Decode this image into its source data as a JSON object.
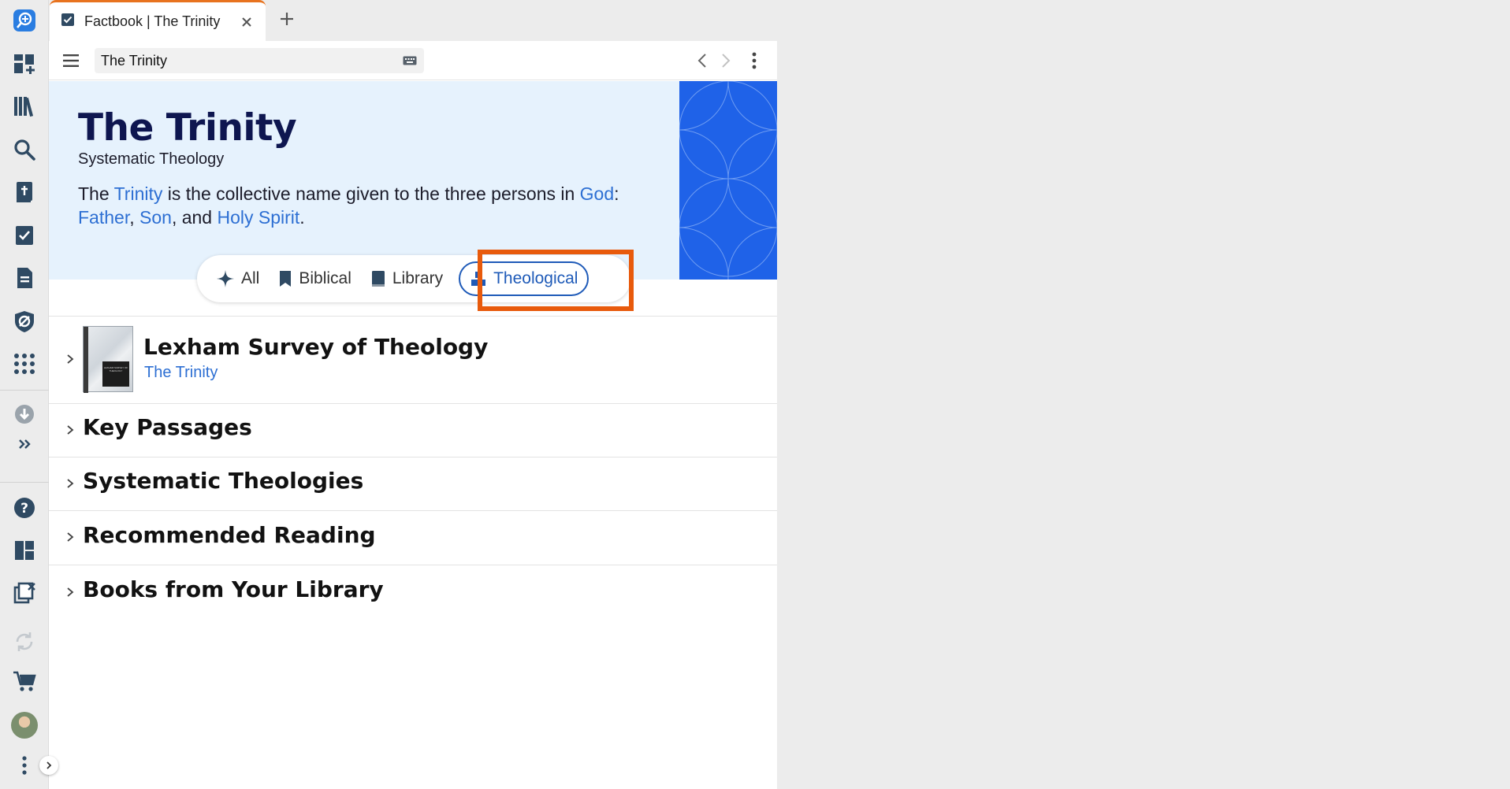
{
  "tab": {
    "title": "Factbook | The Trinity"
  },
  "toolbar": {
    "address_value": "The Trinity"
  },
  "hero": {
    "title": "The Trinity",
    "subtitle": "Systematic Theology",
    "desc_before": "The ",
    "link_trinity": "Trinity",
    "desc_mid1": " is the collective name given to the three persons in ",
    "link_god": "God",
    "desc_mid2": ":",
    "link_father": "Father",
    "desc_sep1": ", ",
    "link_son": "Son",
    "desc_sep2": ", and ",
    "link_holy_spirit": "Holy Spirit",
    "desc_end": "."
  },
  "filters": [
    {
      "label": "All",
      "icon": "sparkle-icon"
    },
    {
      "label": "Biblical",
      "icon": "bookmark-icon"
    },
    {
      "label": "Library",
      "icon": "book-icon"
    },
    {
      "label": "Theological",
      "icon": "blocks-icon",
      "active": true
    }
  ],
  "featured_book": {
    "title": "Lexham Survey of Theology",
    "link": "The Trinity",
    "cover_text": "LEXHAM SURVEY OF THEOLOGY"
  },
  "sections": [
    {
      "title": "Key Passages"
    },
    {
      "title": "Systematic Theologies"
    },
    {
      "title": "Recommended Reading"
    },
    {
      "title": "Books from Your Library"
    }
  ],
  "colors": {
    "accent": "#1e5ab8",
    "link": "#2d6fd3",
    "hero_bg": "#e6f2fd",
    "hero_art": "#1f62e8",
    "tab_accent": "#e8731f",
    "highlight": "#e85a0c",
    "rail_icon": "#2f4a63"
  },
  "rail_icons": [
    "logos-search-icon",
    "dashboard-add-icon",
    "library-icon",
    "search-icon",
    "bible-icon",
    "checklist-icon",
    "document-icon",
    "guides-icon",
    "apps-grid-icon",
    "download-icon",
    "more-chevrons-icon",
    "help-icon",
    "layout-icon",
    "close-panels-icon",
    "sync-icon",
    "cart-icon",
    "avatar",
    "kebab-menu-icon"
  ]
}
